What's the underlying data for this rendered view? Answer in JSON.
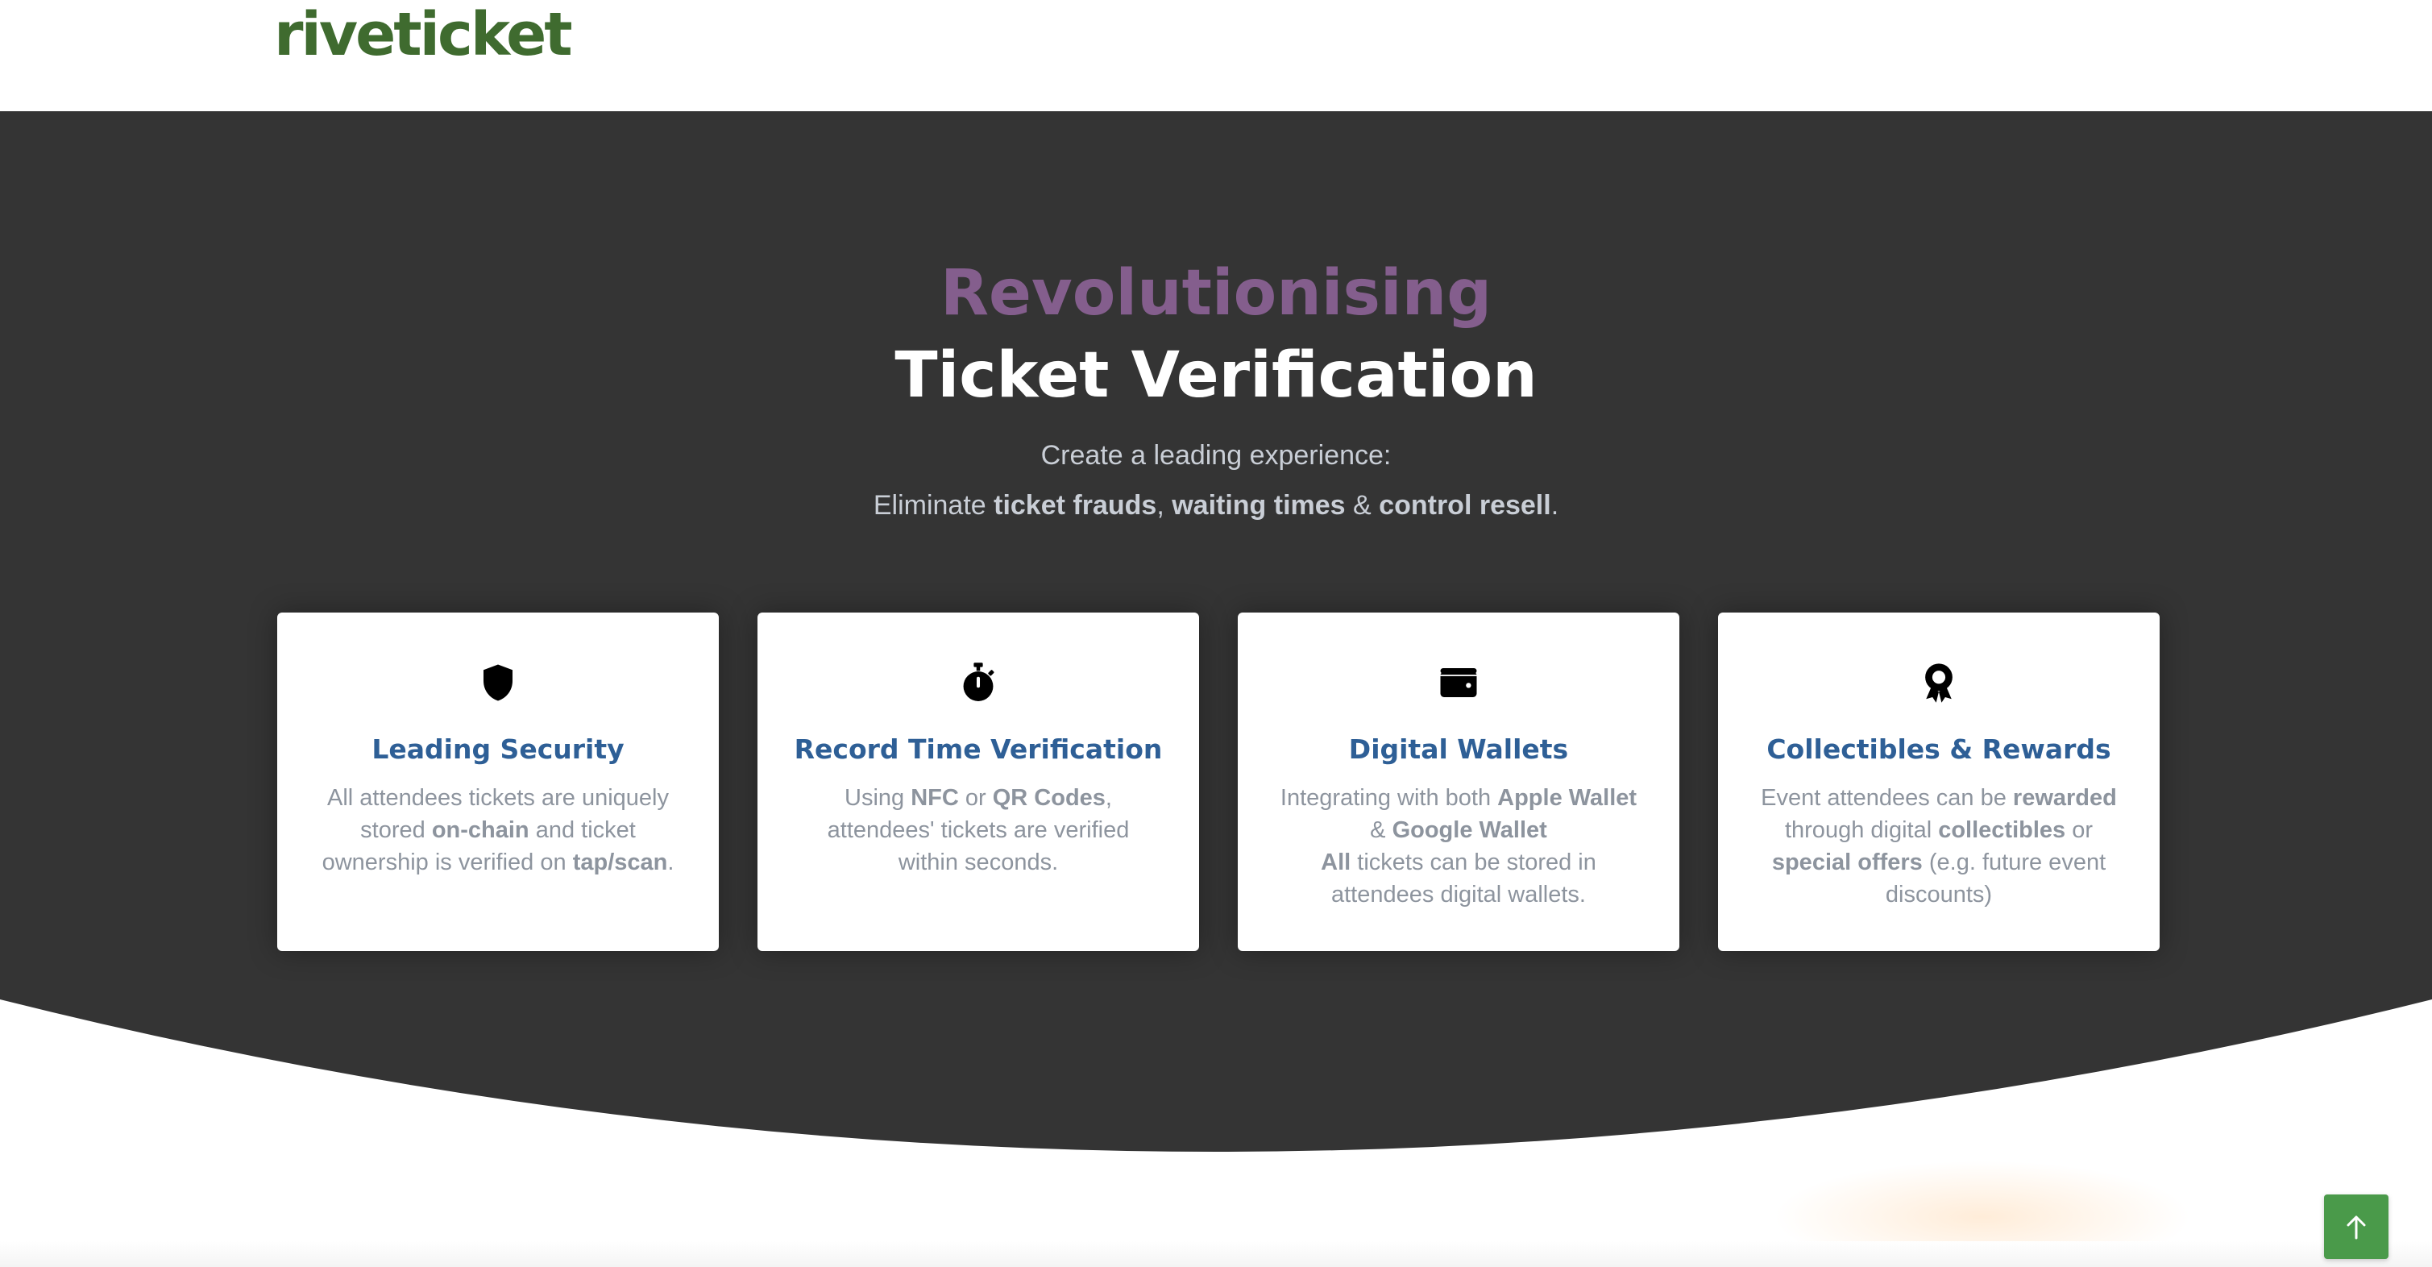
{
  "header": {
    "logo_text": "riveticket"
  },
  "hero": {
    "title_line_1": "Revolutionising",
    "title_line_2": "Ticket Verification",
    "subtitle_1": "Create a leading experience:",
    "subtitle_2": {
      "prefix": "Eliminate ",
      "bold_1": "ticket frauds",
      "sep_1": ", ",
      "bold_2": "waiting times",
      "sep_2": " & ",
      "bold_3": "control resell",
      "suffix": "."
    }
  },
  "cards": [
    {
      "icon": "shield-icon",
      "title": "Leading Security",
      "body": [
        "All attendees tickets are uniquely stored ",
        "on-chain",
        " and ticket ownership is verified on ",
        "tap/scan",
        "."
      ]
    },
    {
      "icon": "stopwatch-icon",
      "title": "Record Time Verification",
      "body": [
        "Using ",
        "NFC",
        " or ",
        "QR Codes",
        ", attendees' tickets are verified within seconds."
      ]
    },
    {
      "icon": "wallet-icon",
      "title": "Digital Wallets",
      "body": [
        "Integrating with both ",
        "Apple Wallet",
        " & ",
        "Google Wallet",
        " ",
        "All",
        " tickets can be stored in attendees digital wallets."
      ]
    },
    {
      "icon": "award-icon",
      "title": "Collectibles & Rewards",
      "body": [
        "Event attendees can be ",
        "rewarded",
        " through digital ",
        "collectibles",
        " or ",
        "special offers",
        " (e.g. future event discounts)"
      ]
    }
  ],
  "colors": {
    "hero_bg": "#343434",
    "accent_purple": "#845e8d",
    "card_title_blue": "#2e5f96",
    "scroll_button_green": "#4a9a4a",
    "logo_green": "#3f6b2f"
  },
  "scroll_top_button": {
    "icon": "arrow-up-icon"
  }
}
